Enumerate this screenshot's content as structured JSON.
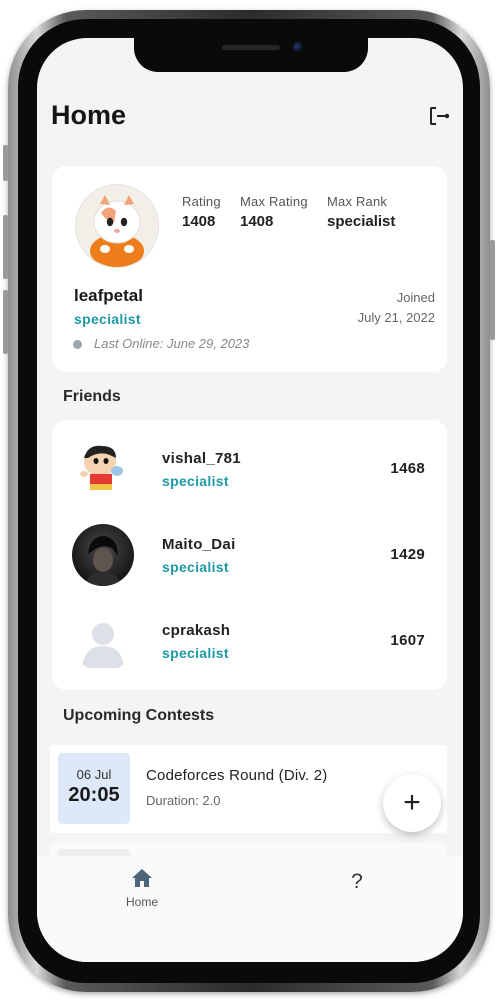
{
  "header": {
    "title": "Home"
  },
  "profile": {
    "stats": [
      {
        "label": "Rating",
        "value": "1408"
      },
      {
        "label": "Max Rating",
        "value": "1408"
      },
      {
        "label": "Max Rank",
        "value": "specialist"
      }
    ],
    "username": "leafpetal",
    "rank": "specialist",
    "joined_label": "Joined",
    "joined_date": "July 21, 2022",
    "last_online": "Last Online: June 29, 2023"
  },
  "friends": {
    "title": "Friends",
    "items": [
      {
        "name": "vishal_781",
        "rank": "specialist",
        "rating": "1468"
      },
      {
        "name": "Maito_Dai",
        "rank": "specialist",
        "rating": "1429"
      },
      {
        "name": "cprakash",
        "rank": "specialist",
        "rating": "1607"
      }
    ]
  },
  "contests": {
    "title": "Upcoming Contests",
    "items": [
      {
        "date": "06 Jul",
        "time": "20:05",
        "name": "Codeforces Round (Div. 2)",
        "duration": "Duration: 2.0"
      }
    ]
  },
  "fab": {
    "icon": "plus-icon",
    "label": "+"
  },
  "nav": {
    "home_label": "Home",
    "home_icon": "home-icon",
    "help_label": "?",
    "help_icon": "help-icon"
  },
  "colors": {
    "accent": "#1e9aa6",
    "date_box": "#dde9f8",
    "background": "#f4f4f4"
  }
}
